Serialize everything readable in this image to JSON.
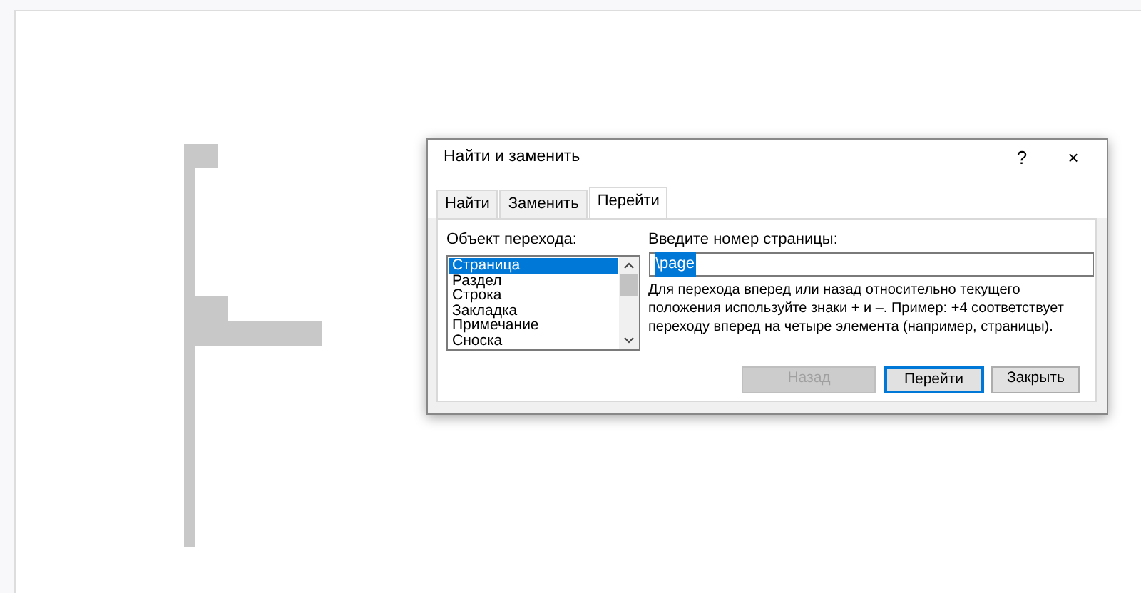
{
  "dialog": {
    "title": "Найти и заменить",
    "help_button": "?",
    "close_button": "×",
    "tabs": [
      {
        "label": "Найти",
        "selected": false
      },
      {
        "label": "Заменить",
        "selected": false
      },
      {
        "label": "Перейти",
        "selected": true
      }
    ],
    "target_label": "Объект перехода:",
    "targets": [
      {
        "label": "Страница",
        "selected": true
      },
      {
        "label": "Раздел",
        "selected": false
      },
      {
        "label": "Строка",
        "selected": false
      },
      {
        "label": "Закладка",
        "selected": false
      },
      {
        "label": "Примечание",
        "selected": false
      },
      {
        "label": "Сноска",
        "selected": false
      }
    ],
    "number_label": "Введите номер страницы:",
    "number_field": {
      "value": "\\page",
      "text_selected": true
    },
    "hint": "Для перехода вперед или назад относительно текущего положения используйте знаки + и –. Пример: +4 соответствует переходу вперед на четыре элемента (например, страницы).",
    "buttons": [
      {
        "label": "Назад",
        "disabled": true,
        "default": false
      },
      {
        "label": "Перейти",
        "disabled": false,
        "default": true
      },
      {
        "label": "Закрыть",
        "disabled": false,
        "default": false
      }
    ]
  }
}
